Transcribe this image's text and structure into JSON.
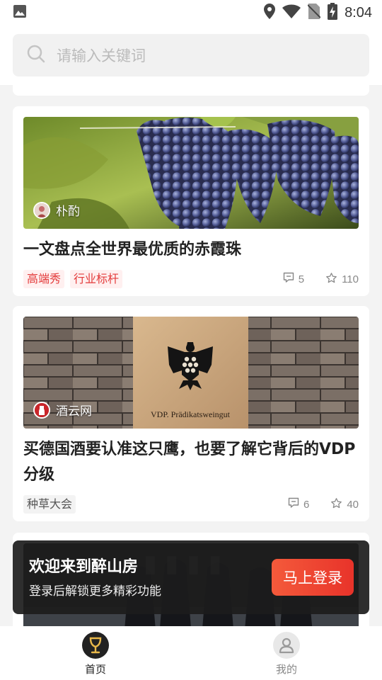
{
  "status_bar": {
    "time": "8:04"
  },
  "search": {
    "placeholder": "请输入关键词"
  },
  "articles": [
    {
      "author": "朴酌",
      "title": "一文盘点全世界最优质的赤霞珠",
      "tags": [
        "高端秀",
        "行业标杆"
      ],
      "comments": "5",
      "favorites": "110"
    },
    {
      "author": "酒云网",
      "title": "买德国酒要认准这只鹰，也要了解它背后的VDP分级",
      "cover_caption": "VDP. Prädikatsweingut",
      "tags": [
        "种草大会"
      ],
      "comments": "6",
      "favorites": "40"
    }
  ],
  "login_banner": {
    "title": "欢迎来到醉山房",
    "subtitle": "登录后解锁更多精彩功能",
    "button": "马上登录"
  },
  "tab_bar": [
    {
      "label": "首页",
      "active": true,
      "color": "#222222"
    },
    {
      "label": "我的",
      "active": false,
      "color": "#888888"
    }
  ]
}
